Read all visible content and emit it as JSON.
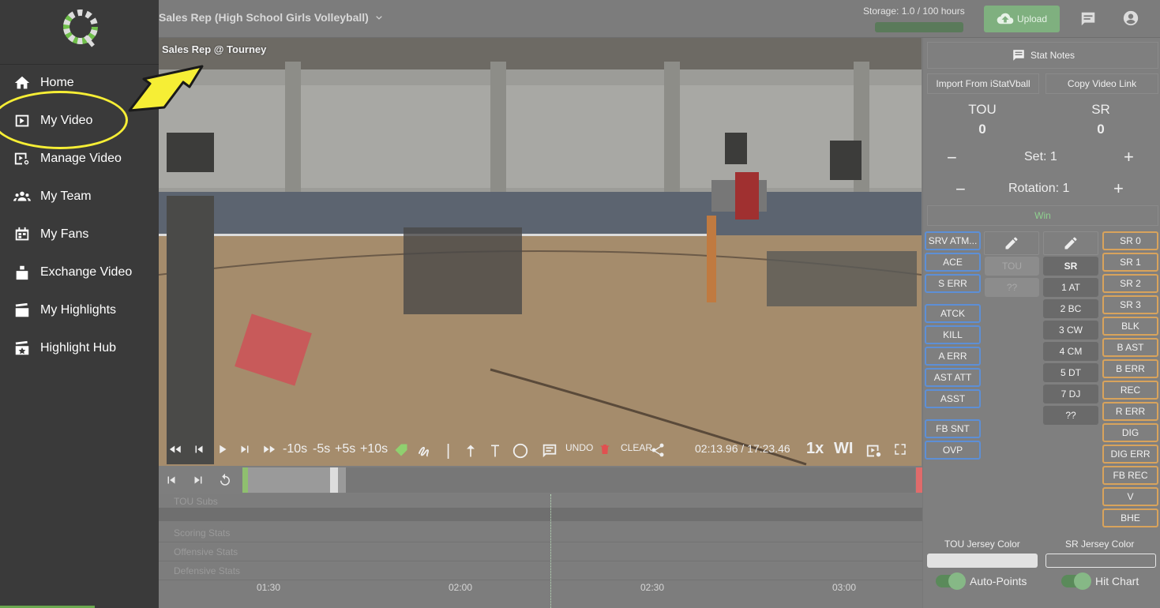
{
  "sidebar": {
    "items": [
      {
        "label": "Home",
        "icon": "home-icon"
      },
      {
        "label": "My Video",
        "icon": "video-icon"
      },
      {
        "label": "Manage Video",
        "icon": "manage-video-icon"
      },
      {
        "label": "My Team",
        "icon": "team-icon"
      },
      {
        "label": "My Fans",
        "icon": "fans-icon"
      },
      {
        "label": "Exchange Video",
        "icon": "exchange-icon"
      },
      {
        "label": "My Highlights",
        "icon": "highlights-icon"
      },
      {
        "label": "Highlight Hub",
        "icon": "highlight-hub-icon"
      }
    ]
  },
  "header": {
    "team_title": "Sales Rep (High School Girls Volleyball)",
    "storage": "Storage: 1.0 / 100 hours",
    "upload_label": "Upload"
  },
  "video": {
    "title": "Sales Rep @ Tourney",
    "skip_labels": [
      "-10s",
      "-5s",
      "+5s",
      "+10s"
    ],
    "undo_label": "UNDO",
    "clear_label": "CLEAR",
    "time": "02:13.96 / 17:23.46",
    "speed": "1x",
    "wi_label": "WI"
  },
  "timeline": {
    "tracks": [
      "TOU Subs",
      "Scoring Stats",
      "Offensive Stats",
      "Defensive Stats"
    ],
    "ticks": [
      "01:30",
      "02:00",
      "02:30",
      "03:00"
    ]
  },
  "panel": {
    "stat_notes": "Stat Notes",
    "import_label": "Import From iStatVball",
    "copy_link_label": "Copy Video Link",
    "home_team": "TOU",
    "away_team": "SR",
    "home_score": "0",
    "away_score": "0",
    "set_label": "Set: 1",
    "rotation_label": "Rotation: 1",
    "minus": "−",
    "plus": "+",
    "win_label": "Win",
    "blue_buttons": [
      "SRV ATM...",
      "ACE",
      "S ERR",
      "ATCK",
      "KILL",
      "A ERR",
      "AST ATT",
      "ASST",
      "FB SNT",
      "OVP"
    ],
    "tou_players": [
      "TOU",
      "??"
    ],
    "sr_players": [
      "SR",
      "1 AT",
      "2 BC",
      "3 CW",
      "4 CM",
      "5 DT",
      "7 DJ",
      "??"
    ],
    "orange_buttons": [
      "SR 0",
      "SR 1",
      "SR 2",
      "SR 3",
      "BLK",
      "B AST",
      "B ERR",
      "REC",
      "R ERR",
      "DIG",
      "DIG ERR",
      "FB REC",
      "V",
      "BHE"
    ],
    "tou_jersey_label": "TOU Jersey Color",
    "sr_jersey_label": "SR Jersey Color",
    "auto_points_label": "Auto-Points",
    "hit_chart_label": "Hit Chart"
  },
  "colors": {
    "tou_jersey": "#e2e2e2",
    "sr_jersey": "#7f7f7f",
    "accent_green": "#7fb07f",
    "annotation_yellow": "#f6ee35"
  }
}
